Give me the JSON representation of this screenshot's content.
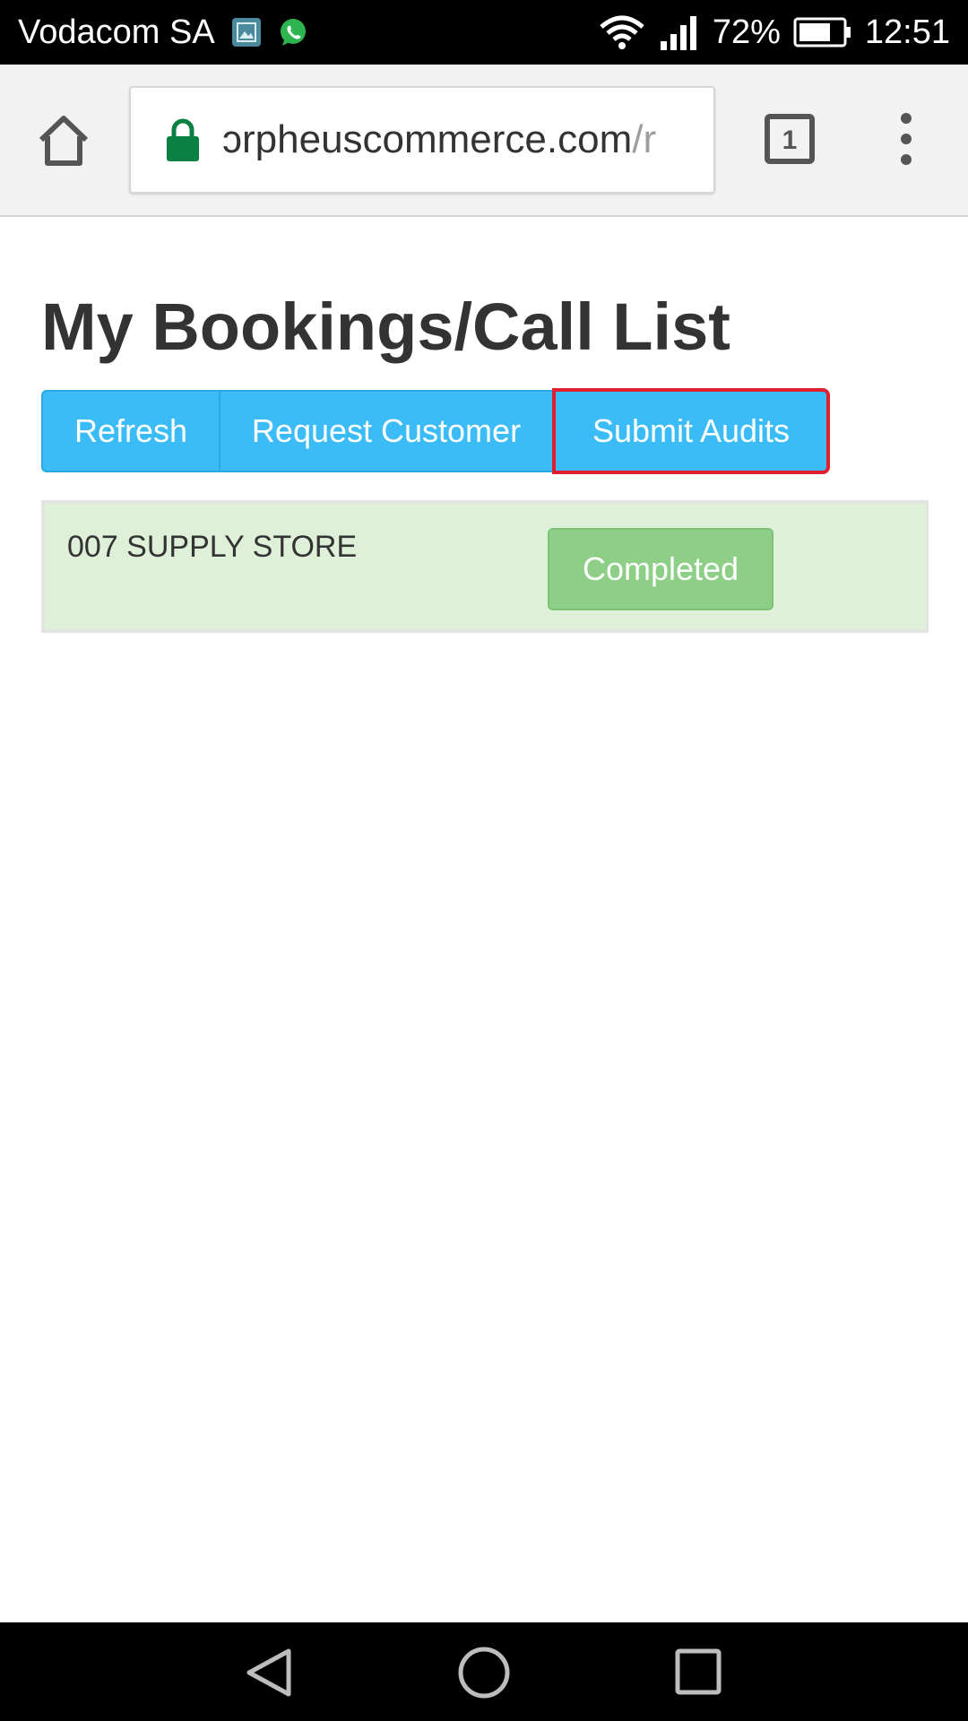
{
  "status_bar": {
    "carrier": "Vodacom SA",
    "battery_percent": "72%",
    "time": "12:51",
    "notification_icons": [
      "gallery-icon",
      "whatsapp-icon"
    ]
  },
  "browser": {
    "url_main": "ɔrpheuscommerce.com",
    "url_path": "/r",
    "tab_count": "1"
  },
  "page": {
    "title": "My Bookings/Call List",
    "buttons": {
      "refresh": "Refresh",
      "request_customer": "Request Customer",
      "submit_audits": "Submit Audits"
    },
    "bookings": [
      {
        "store": "007 SUPPLY STORE",
        "status": "Completed"
      }
    ]
  },
  "colors": {
    "primary_button": "#3bbcf6",
    "success_row": "#dff0d8",
    "success_button": "#8dcf86",
    "highlight_outline": "#e02030",
    "lock_green": "#0b8043"
  }
}
